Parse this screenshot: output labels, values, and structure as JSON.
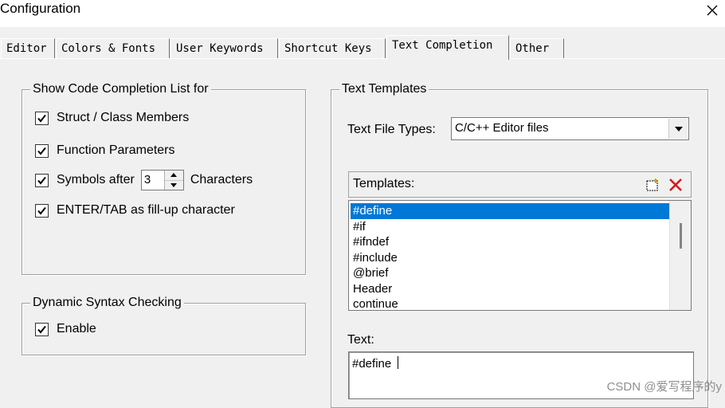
{
  "window": {
    "title": "Configuration"
  },
  "tabs": [
    {
      "label": "Editor"
    },
    {
      "label": "Colors & Fonts"
    },
    {
      "label": "User Keywords"
    },
    {
      "label": "Shortcut Keys"
    },
    {
      "label": "Text Completion"
    },
    {
      "label": "Other"
    }
  ],
  "active_tab": "Text Completion",
  "completion_list": {
    "title": "Show Code Completion List for",
    "items": [
      {
        "label": "Struct / Class Members",
        "checked": true
      },
      {
        "label": "Function Parameters",
        "checked": true
      },
      {
        "label": "Symbols after",
        "checked": true
      },
      {
        "label": "ENTER/TAB as fill-up character",
        "checked": true
      }
    ],
    "symbols_count": "3",
    "symbols_suffix": "Characters"
  },
  "syntax": {
    "title": "Dynamic Syntax Checking",
    "enable_label": "Enable",
    "enabled": true
  },
  "templates": {
    "title": "Text Templates",
    "file_types_label": "Text File Types:",
    "file_types_value": "C/C++ Editor files",
    "list_label": "Templates:",
    "items": [
      "#define",
      "#if",
      "#ifndef",
      "#include",
      "@brief",
      "Header",
      "continue"
    ],
    "selected": "#define",
    "text_label": "Text:",
    "text_value": "#define"
  },
  "icons": {
    "close": "close-icon",
    "new_template": "new-template-icon",
    "delete_template": "delete-icon",
    "checkbox": "checkmark-icon",
    "dropdown": "chevron-down-icon"
  },
  "colors": {
    "selection": "#0078d7",
    "delete_icon": "#d41a1a"
  },
  "watermark": "CSDN @爱写程序的y"
}
